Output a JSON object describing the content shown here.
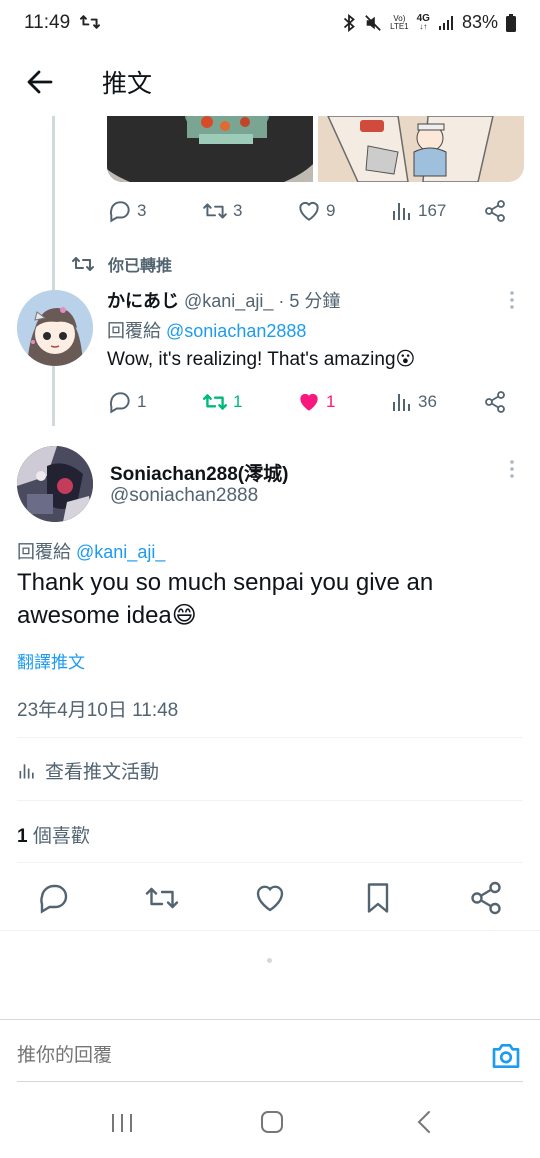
{
  "status_bar": {
    "time": "11:49",
    "lte_top": "Vo)",
    "lte_bottom": "LTE1",
    "net_top": "4G",
    "battery": "83%"
  },
  "header": {
    "title": "推文"
  },
  "prev_tweet": {
    "replies": "3",
    "retweets": "3",
    "likes": "9",
    "views": "167"
  },
  "rt_notice": "你已轉推",
  "reply_tweet": {
    "name": "かにあじ",
    "handle": "@kani_aji_",
    "time": "· 5 分鐘",
    "reply_to_label": "回覆給",
    "reply_to_handle": "@soniachan2888",
    "text": "Wow, it's realizing! That's amazing😮",
    "replies": "1",
    "retweets": "1",
    "likes": "1",
    "views": "36"
  },
  "main_tweet": {
    "name": "Soniachan288(澪城)",
    "handle": "@soniachan2888",
    "reply_to_label": "回覆給",
    "reply_to_handle": "@kani_aji_",
    "text": "Thank you so much senpai you give an awesome idea😄",
    "translate": "翻譯推文",
    "timestamp": "23年4月10日 11:48",
    "activity": "查看推文活動",
    "likes_count": "1",
    "likes_label": "個喜歡"
  },
  "reply_bar": {
    "placeholder": "推你的回覆"
  },
  "colors": {
    "accent": "#1d9bf0",
    "retweet_green": "#00ba7c",
    "like_pink": "#f91880",
    "muted": "#536471"
  }
}
